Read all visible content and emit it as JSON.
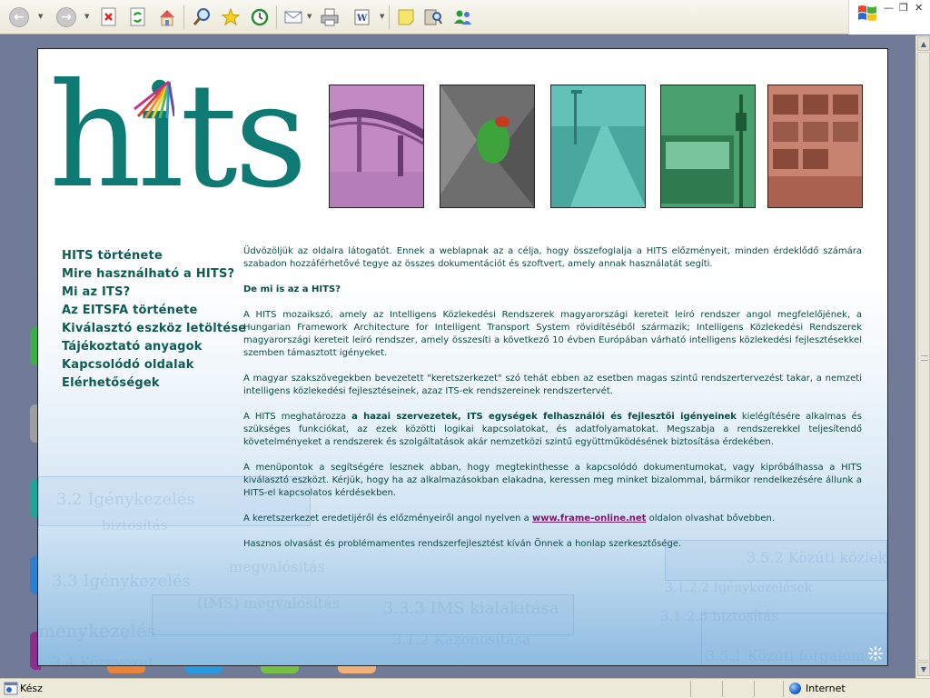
{
  "browser": {
    "toolbar_icons": [
      "back-icon",
      "forward-icon",
      "stop-icon",
      "refresh-icon",
      "home-icon",
      "search-icon",
      "favorites-icon",
      "history-icon",
      "mail-icon",
      "print-icon",
      "word-edit-icon",
      "notes-icon",
      "research-icon",
      "messenger-icon"
    ],
    "window_controls": [
      "minimize",
      "restore",
      "close"
    ]
  },
  "page": {
    "logo_text": "hits",
    "photos": [
      "bridge-photo",
      "green-bug-photo",
      "highway-photo",
      "bus-photo",
      "traffic-control-photo"
    ],
    "nav": [
      {
        "label": "HITS története"
      },
      {
        "label": "Mire használható a HITS?"
      },
      {
        "label": "Mi az ITS?"
      },
      {
        "label": "Az EITSFA története"
      },
      {
        "label": "Kiválasztó eszköz letöltése"
      },
      {
        "label": "Tájékoztató anyagok"
      },
      {
        "label": "Kapcsolódó oldalak"
      },
      {
        "label": "Elérhetőségek"
      }
    ],
    "content": {
      "p1": "Üdvözöljük az oldalra látogatót. Ennek a weblapnak az a célja, hogy összefoglalja a HITS előzményeit, minden érdeklődő számára szabadon hozzáférhetővé tegye az összes dokumentációt és szoftvert, amely annak használatát segíti.",
      "heading": "De mi is az a HITS?",
      "p2": "A HITS mozaikszó, amely az Intelligens Közlekedési Rendszerek magyarországi kereteit leíró rendszer angol megfelelőjének, a Hungarian Framework Architecture for Intelligent Transport System rövidítéséből származik; Intelligens Közlekedési Rendszerek magyarországi kereteit leíró rendszer, amely összesíti a következő 10 évben Európában várható intelligens közlekedési fejlesztésekkel szemben támasztott igényeket.",
      "p3": "A magyar szakszövegekben bevezetett \"keretszerkezet\" szó tehát ebben az esetben magas szintű rendszertervezést takar, a nemzeti intelligens közlekedési fejlesztéseinek, azaz ITS-ek rendszereinek rendszertervét.",
      "p4_start": "A HITS meghatározza ",
      "p4_bold": "a hazai szervezetek, ITS egységek felhasználói és fejlesztői igényeinek",
      "p4_end": " kielégítésére alkalmas és szükséges funkciókat, az ezek közötti logikai kapcsolatokat, és adatfolyamatokat. Megszabja a rendszerekkel teljesítendő követelményeket a rendszerek és szolgáltatások akár nemzetközi szintű együttműködésének biztosítása érdekében.",
      "p5": "A menüpontok a segítségére lesznek abban, hogy megtekinthesse a kapcsolódó dokumentumokat, vagy kipróbálhassa a HITS kiválasztó eszközt. Kérjük, hogy ha az alkalmazásokban elakadna, keressen meg minket bizalommal, bármikor rendelkezésére állunk a HITS-el kapcsolatos kérdésekben.",
      "p6_start": "A keretszerkezet eredetijéről és előzményeiről angol nyelven a ",
      "p6_link": "www.frame-online.net",
      "p6_end": " oldalon olvashat bővebben.",
      "p7": "Hasznos olvasást és problémamentes rendszerfejlesztést kíván Önnek a honlap szerkesztősége."
    },
    "background_words": [
      "3.2 Igénykezelés",
      "3.3 Igénykezelés",
      "3.3.3 IMS kialakítása",
      "(IMS) megvalósítás",
      "menykezelés",
      "3.1.2 Kazonosítása",
      "biztosítás",
      "3.4 Környezet",
      "3.5.1 Közúti forgalom",
      "3.1.2.3 biztosítás",
      "3.5.2 Közúti közlekedés",
      "3.1.2.2 Igénykezelések",
      "megvalósítás"
    ],
    "colors": {
      "logo": "#0f7a73",
      "nav": "#0e5a55",
      "text": "#0b4a47",
      "link": "#7a1a6b",
      "photo_tints": [
        "#b17fb8",
        "#777777",
        "#56bab2",
        "#3d9b6b",
        "#c07a66"
      ],
      "side_tabs": [
        "#3dae4a",
        "#9e9e9e",
        "#1fa59a",
        "#2d7fd0",
        "#8b2f8d"
      ],
      "bottom_tabs": [
        "#e8853d",
        "#2a9be0",
        "#76c043",
        "#f0b27a"
      ]
    }
  },
  "status": {
    "text": "Kész",
    "zone": "Internet"
  }
}
